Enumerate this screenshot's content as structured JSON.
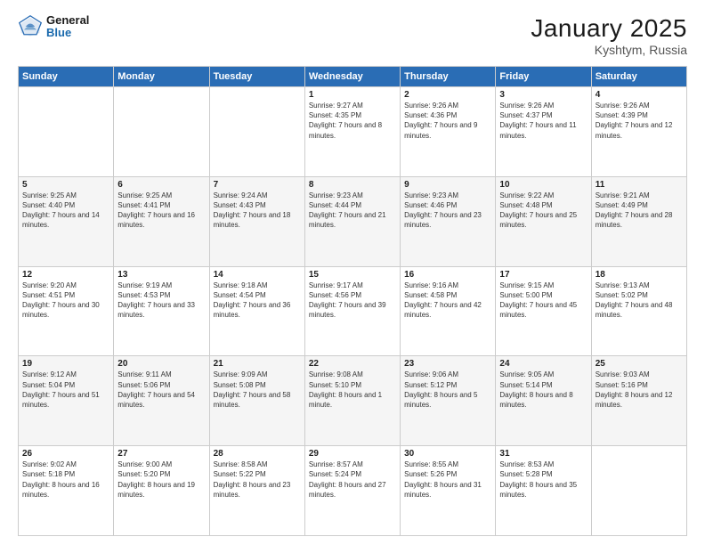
{
  "header": {
    "logo_general": "General",
    "logo_blue": "Blue",
    "title": "January 2025",
    "subtitle": "Kyshtym, Russia"
  },
  "days_of_week": [
    "Sunday",
    "Monday",
    "Tuesday",
    "Wednesday",
    "Thursday",
    "Friday",
    "Saturday"
  ],
  "weeks": [
    [
      {
        "day": "",
        "sunrise": "",
        "sunset": "",
        "daylight": ""
      },
      {
        "day": "",
        "sunrise": "",
        "sunset": "",
        "daylight": ""
      },
      {
        "day": "",
        "sunrise": "",
        "sunset": "",
        "daylight": ""
      },
      {
        "day": "1",
        "sunrise": "Sunrise: 9:27 AM",
        "sunset": "Sunset: 4:35 PM",
        "daylight": "Daylight: 7 hours and 8 minutes."
      },
      {
        "day": "2",
        "sunrise": "Sunrise: 9:26 AM",
        "sunset": "Sunset: 4:36 PM",
        "daylight": "Daylight: 7 hours and 9 minutes."
      },
      {
        "day": "3",
        "sunrise": "Sunrise: 9:26 AM",
        "sunset": "Sunset: 4:37 PM",
        "daylight": "Daylight: 7 hours and 11 minutes."
      },
      {
        "day": "4",
        "sunrise": "Sunrise: 9:26 AM",
        "sunset": "Sunset: 4:39 PM",
        "daylight": "Daylight: 7 hours and 12 minutes."
      }
    ],
    [
      {
        "day": "5",
        "sunrise": "Sunrise: 9:25 AM",
        "sunset": "Sunset: 4:40 PM",
        "daylight": "Daylight: 7 hours and 14 minutes."
      },
      {
        "day": "6",
        "sunrise": "Sunrise: 9:25 AM",
        "sunset": "Sunset: 4:41 PM",
        "daylight": "Daylight: 7 hours and 16 minutes."
      },
      {
        "day": "7",
        "sunrise": "Sunrise: 9:24 AM",
        "sunset": "Sunset: 4:43 PM",
        "daylight": "Daylight: 7 hours and 18 minutes."
      },
      {
        "day": "8",
        "sunrise": "Sunrise: 9:23 AM",
        "sunset": "Sunset: 4:44 PM",
        "daylight": "Daylight: 7 hours and 21 minutes."
      },
      {
        "day": "9",
        "sunrise": "Sunrise: 9:23 AM",
        "sunset": "Sunset: 4:46 PM",
        "daylight": "Daylight: 7 hours and 23 minutes."
      },
      {
        "day": "10",
        "sunrise": "Sunrise: 9:22 AM",
        "sunset": "Sunset: 4:48 PM",
        "daylight": "Daylight: 7 hours and 25 minutes."
      },
      {
        "day": "11",
        "sunrise": "Sunrise: 9:21 AM",
        "sunset": "Sunset: 4:49 PM",
        "daylight": "Daylight: 7 hours and 28 minutes."
      }
    ],
    [
      {
        "day": "12",
        "sunrise": "Sunrise: 9:20 AM",
        "sunset": "Sunset: 4:51 PM",
        "daylight": "Daylight: 7 hours and 30 minutes."
      },
      {
        "day": "13",
        "sunrise": "Sunrise: 9:19 AM",
        "sunset": "Sunset: 4:53 PM",
        "daylight": "Daylight: 7 hours and 33 minutes."
      },
      {
        "day": "14",
        "sunrise": "Sunrise: 9:18 AM",
        "sunset": "Sunset: 4:54 PM",
        "daylight": "Daylight: 7 hours and 36 minutes."
      },
      {
        "day": "15",
        "sunrise": "Sunrise: 9:17 AM",
        "sunset": "Sunset: 4:56 PM",
        "daylight": "Daylight: 7 hours and 39 minutes."
      },
      {
        "day": "16",
        "sunrise": "Sunrise: 9:16 AM",
        "sunset": "Sunset: 4:58 PM",
        "daylight": "Daylight: 7 hours and 42 minutes."
      },
      {
        "day": "17",
        "sunrise": "Sunrise: 9:15 AM",
        "sunset": "Sunset: 5:00 PM",
        "daylight": "Daylight: 7 hours and 45 minutes."
      },
      {
        "day": "18",
        "sunrise": "Sunrise: 9:13 AM",
        "sunset": "Sunset: 5:02 PM",
        "daylight": "Daylight: 7 hours and 48 minutes."
      }
    ],
    [
      {
        "day": "19",
        "sunrise": "Sunrise: 9:12 AM",
        "sunset": "Sunset: 5:04 PM",
        "daylight": "Daylight: 7 hours and 51 minutes."
      },
      {
        "day": "20",
        "sunrise": "Sunrise: 9:11 AM",
        "sunset": "Sunset: 5:06 PM",
        "daylight": "Daylight: 7 hours and 54 minutes."
      },
      {
        "day": "21",
        "sunrise": "Sunrise: 9:09 AM",
        "sunset": "Sunset: 5:08 PM",
        "daylight": "Daylight: 7 hours and 58 minutes."
      },
      {
        "day": "22",
        "sunrise": "Sunrise: 9:08 AM",
        "sunset": "Sunset: 5:10 PM",
        "daylight": "Daylight: 8 hours and 1 minute."
      },
      {
        "day": "23",
        "sunrise": "Sunrise: 9:06 AM",
        "sunset": "Sunset: 5:12 PM",
        "daylight": "Daylight: 8 hours and 5 minutes."
      },
      {
        "day": "24",
        "sunrise": "Sunrise: 9:05 AM",
        "sunset": "Sunset: 5:14 PM",
        "daylight": "Daylight: 8 hours and 8 minutes."
      },
      {
        "day": "25",
        "sunrise": "Sunrise: 9:03 AM",
        "sunset": "Sunset: 5:16 PM",
        "daylight": "Daylight: 8 hours and 12 minutes."
      }
    ],
    [
      {
        "day": "26",
        "sunrise": "Sunrise: 9:02 AM",
        "sunset": "Sunset: 5:18 PM",
        "daylight": "Daylight: 8 hours and 16 minutes."
      },
      {
        "day": "27",
        "sunrise": "Sunrise: 9:00 AM",
        "sunset": "Sunset: 5:20 PM",
        "daylight": "Daylight: 8 hours and 19 minutes."
      },
      {
        "day": "28",
        "sunrise": "Sunrise: 8:58 AM",
        "sunset": "Sunset: 5:22 PM",
        "daylight": "Daylight: 8 hours and 23 minutes."
      },
      {
        "day": "29",
        "sunrise": "Sunrise: 8:57 AM",
        "sunset": "Sunset: 5:24 PM",
        "daylight": "Daylight: 8 hours and 27 minutes."
      },
      {
        "day": "30",
        "sunrise": "Sunrise: 8:55 AM",
        "sunset": "Sunset: 5:26 PM",
        "daylight": "Daylight: 8 hours and 31 minutes."
      },
      {
        "day": "31",
        "sunrise": "Sunrise: 8:53 AM",
        "sunset": "Sunset: 5:28 PM",
        "daylight": "Daylight: 8 hours and 35 minutes."
      },
      {
        "day": "",
        "sunrise": "",
        "sunset": "",
        "daylight": ""
      }
    ]
  ]
}
